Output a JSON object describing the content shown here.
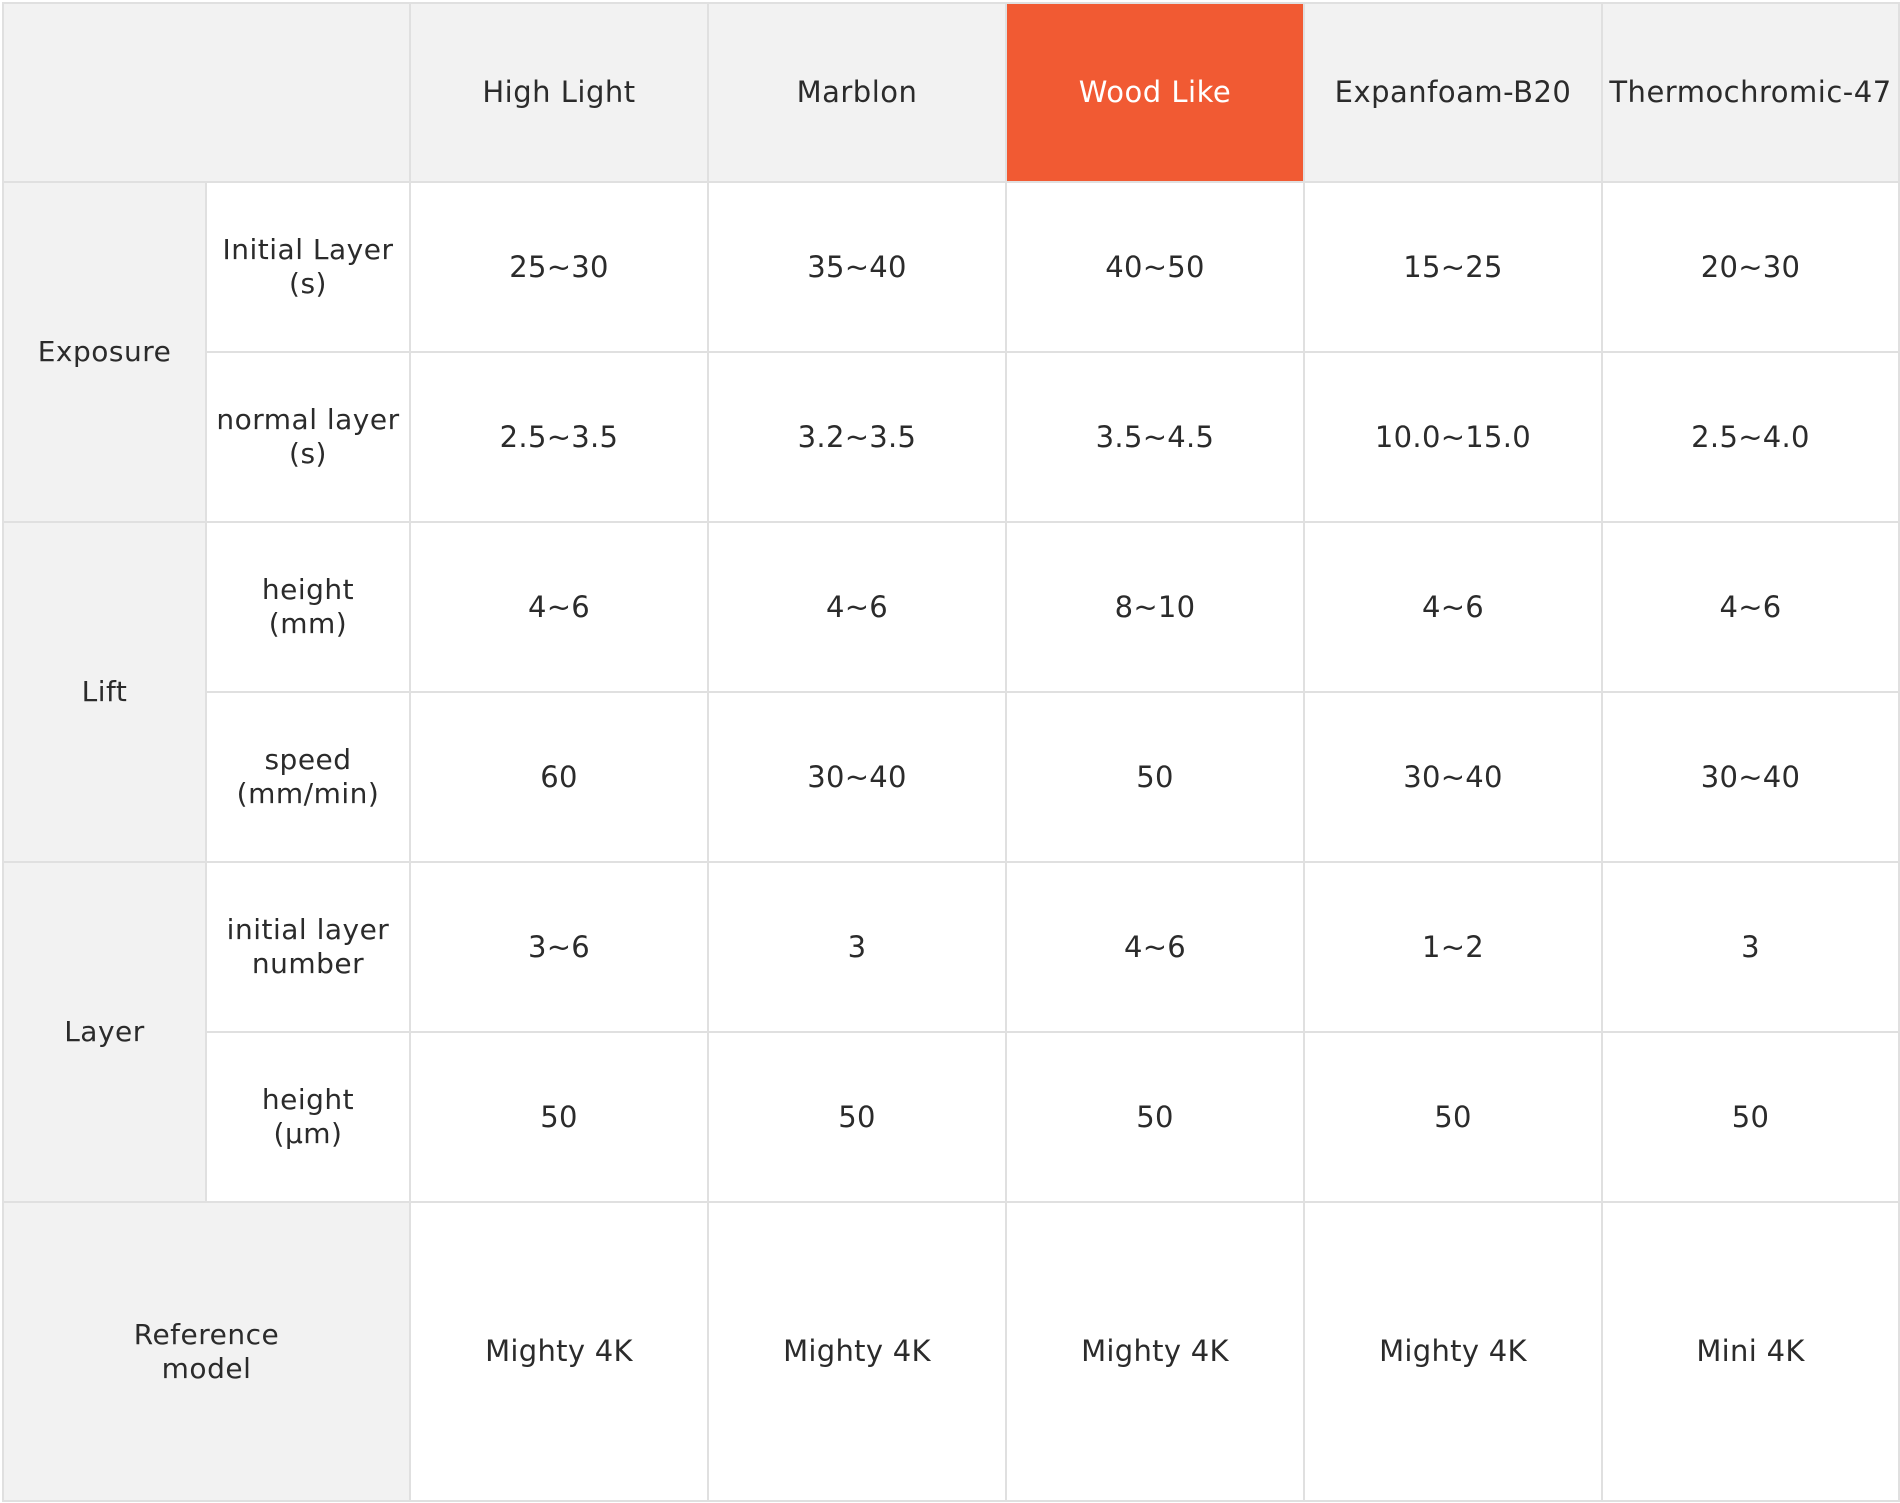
{
  "columns": [
    "High Light",
    "Marblon",
    "Wood Like",
    "Expanfoam-B20",
    "Thermochromic-47"
  ],
  "highlight_color": "#f15a33",
  "groups": {
    "exposure": "Exposure",
    "lift": "Lift",
    "layer": "Layer"
  },
  "rows": [
    {
      "label_1": "Initial Layer",
      "label_2": "(s)",
      "values": [
        "25~30",
        "35~40",
        "40~50",
        "15~25",
        "20~30"
      ]
    },
    {
      "label_1": "normal layer",
      "label_2": "(s)",
      "values": [
        "2.5~3.5",
        "3.2~3.5",
        "3.5~4.5",
        "10.0~15.0",
        "2.5~4.0"
      ]
    },
    {
      "label_1": "height",
      "label_2": "(mm)",
      "values": [
        "4~6",
        "4~6",
        "8~10",
        "4~6",
        "4~6"
      ]
    },
    {
      "label_1": "speed",
      "label_2": "(mm/min)",
      "values": [
        "60",
        "30~40",
        "50",
        "30~40",
        "30~40"
      ]
    },
    {
      "label_1": "initial layer",
      "label_2": "number",
      "values": [
        "3~6",
        "3",
        "4~6",
        "1~2",
        "3"
      ]
    },
    {
      "label_1": "height",
      "label_2": "(µm)",
      "values": [
        "50",
        "50",
        "50",
        "50",
        "50"
      ]
    }
  ],
  "reference": {
    "label_1": "Reference",
    "label_2": "model",
    "values": [
      "Mighty 4K",
      "Mighty 4K",
      "Mighty 4K",
      "Mighty 4K",
      "Mini 4K"
    ]
  }
}
